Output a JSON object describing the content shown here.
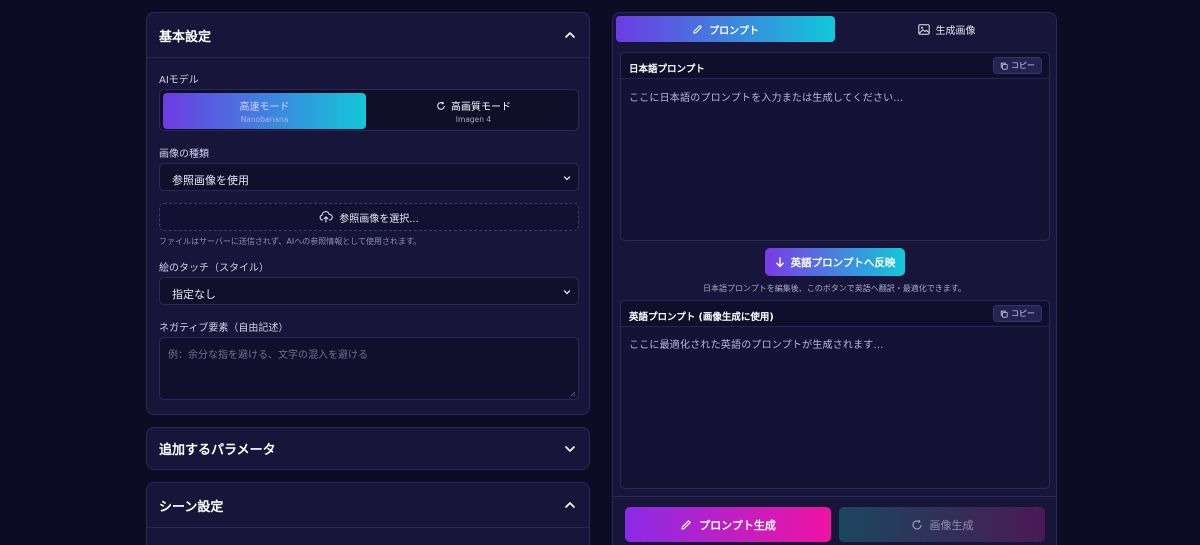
{
  "left": {
    "basic": {
      "title": "基本設定",
      "ai_model_label": "AIモデル",
      "model_fast": {
        "label": "高速モード",
        "sub": "Nanobanana"
      },
      "model_hq": {
        "label": "高画質モード",
        "sub": "Imagen 4"
      },
      "image_type_label": "画像の種類",
      "image_type_value": "参照画像を使用",
      "upload_label": "参照画像を選択...",
      "upload_hint": "ファイルはサーバーに送信されず、AIへの参照情報として使用されます。",
      "style_label": "絵のタッチ（スタイル）",
      "style_value": "指定なし",
      "negative_label": "ネガティブ要素（自由記述）",
      "negative_placeholder": "例：余分な指を避ける、文字の混入を避ける"
    },
    "params": {
      "title": "追加するパラメータ"
    },
    "scene": {
      "title": "シーン設定"
    }
  },
  "right": {
    "tabs": {
      "prompt": "プロンプト",
      "image": "生成画像"
    },
    "jp": {
      "title": "日本語プロンプト",
      "copy": "コピー",
      "placeholder": "ここに日本語のプロンプトを入力または生成してください..."
    },
    "reflect": {
      "label": "英語プロンプトへ反映",
      "hint": "日本語プロンプトを編集後、このボタンで英語へ翻訳・最適化できます。"
    },
    "en": {
      "title": "英語プロンプト (画像生成に使用)",
      "copy": "コピー",
      "placeholder": "ここに最適化された英語のプロンプトが生成されます..."
    },
    "actions": {
      "prompt_gen": "プロンプト生成",
      "image_gen": "画像生成"
    }
  },
  "colors": {
    "accent_start": "#6d3be4",
    "accent_end": "#12c8d8",
    "pink_end": "#f013a2",
    "bg": "#0d0c24",
    "panel": "#17163a"
  },
  "icons": {
    "pencil": "pencil-icon",
    "image": "image-icon",
    "copy": "copy-icon",
    "refresh": "refresh-icon",
    "upload": "upload-icon",
    "arrow_down": "arrow-down-icon",
    "chevron": "chevron-icon"
  }
}
